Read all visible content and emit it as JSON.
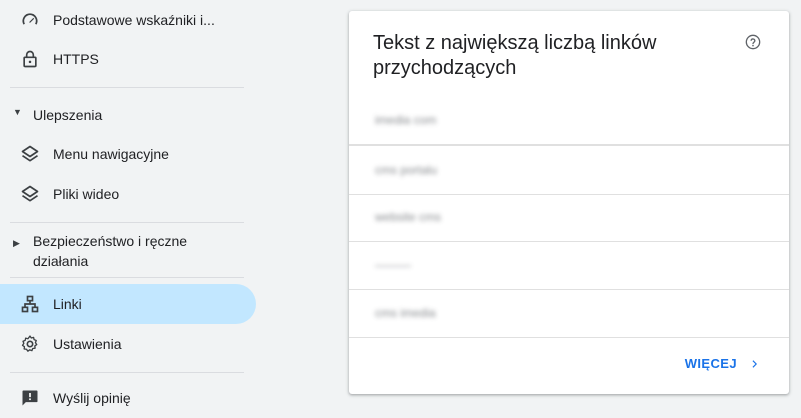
{
  "sidebar": {
    "items": [
      {
        "label": "Podstawowe wskaźniki i...",
        "icon": "speedometer-icon"
      },
      {
        "label": "HTTPS",
        "icon": "lock-icon"
      },
      {
        "label": "Menu nawigacyjne",
        "icon": "layers-icon"
      },
      {
        "label": "Pliki wideo",
        "icon": "layers-icon"
      },
      {
        "label": "Linki",
        "icon": "sitemap-icon"
      },
      {
        "label": "Ustawienia",
        "icon": "gear-icon"
      },
      {
        "label": "Wyślij opinię",
        "icon": "feedback-icon"
      }
    ],
    "sections": {
      "ulepszenia": "Ulepszenia",
      "bezpieczenstwo_line1": "Bezpieczeństwo i ręczne",
      "bezpieczenstwo_line2": "działania"
    },
    "active_item": "Linki",
    "active_color": "#c2e7ff"
  },
  "card": {
    "title_line1": "Tekst z największą liczbą linków",
    "title_line2": "przychodzących",
    "help_icon": "help-circle-icon",
    "rows": [
      "imedia com",
      "cms portalu",
      "website cms",
      "———",
      "cms imedia"
    ],
    "more_label": "WIĘCEJ",
    "accent": "#1a73e8"
  }
}
